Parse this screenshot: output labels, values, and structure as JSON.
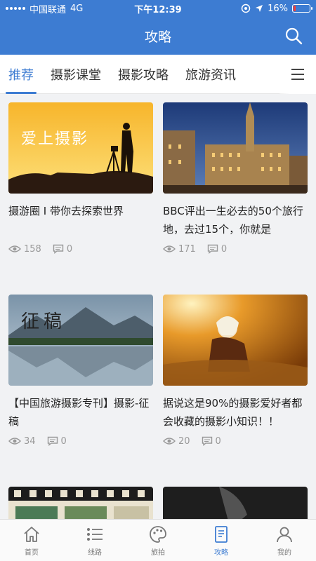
{
  "status_bar": {
    "carrier": "中国联通",
    "network": "4G",
    "time": "下午12:39",
    "battery": "16%",
    "battery_level": 0.16
  },
  "header": {
    "title": "攻略",
    "search_icon": "search-icon"
  },
  "tabs": [
    {
      "label": "推荐",
      "active": true
    },
    {
      "label": "摄影课堂",
      "active": false
    },
    {
      "label": "摄影攻略",
      "active": false
    },
    {
      "label": "旅游资讯",
      "active": false
    }
  ],
  "tabs_more_icon": "menu-icon",
  "feed": [
    {
      "title": "摄游圈 I 带你去探索世界",
      "image_text": "爱上摄影",
      "views": "158",
      "comments": "0"
    },
    {
      "title": "BBC评出一生必去的50个旅行地，去过15个，你就是",
      "image_text": "",
      "views": "171",
      "comments": "0"
    },
    {
      "title": "【中国旅游摄影专刊】摄影-征稿",
      "image_text": "征稿",
      "views": "34",
      "comments": "0"
    },
    {
      "title": "据说这是90%的摄影爱好者都会收藏的摄影小知识！！",
      "image_text": "",
      "views": "20",
      "comments": "0"
    }
  ],
  "tabbar": [
    {
      "label": "首页",
      "icon": "home-icon",
      "active": false
    },
    {
      "label": "线路",
      "icon": "route-list-icon",
      "active": false
    },
    {
      "label": "旅拍",
      "icon": "palette-icon",
      "active": false
    },
    {
      "label": "攻略",
      "icon": "guide-document-icon",
      "active": true
    },
    {
      "label": "我的",
      "icon": "user-icon",
      "active": false
    }
  ],
  "colors": {
    "primary": "#3d7cd2",
    "meta_gray": "#999999"
  }
}
